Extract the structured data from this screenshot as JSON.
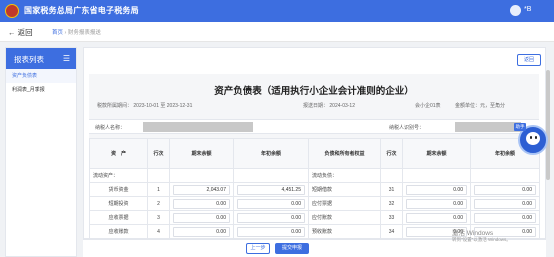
{
  "header": {
    "title": "国家税务总局广东省电子税务局",
    "user": "*B"
  },
  "subbar": {
    "back_label": "返回",
    "crumb_home": "首页",
    "crumb_sep": " › ",
    "crumb_current": "财务报表报送"
  },
  "sidebar": {
    "title": "报表列表",
    "items": [
      {
        "label": "资产负债表",
        "active": true
      },
      {
        "label": "利润表_月季报",
        "active": false
      }
    ]
  },
  "main": {
    "return_label": "返回",
    "form_title": "资产负债表（适用执行小企业会计准则的企业）",
    "meta": {
      "period_label": "税款所属期间：",
      "period_start": "2023-10-01",
      "period_to": "至",
      "period_end": "2023-12-31",
      "fill_date_label": "报送日期：",
      "fill_date": "2024-03-12",
      "form_code": "会小企01表",
      "unit_label": "金额单位：元，至角分"
    },
    "taxpayer_name_label": "纳税人名称：",
    "taxpayer_id_label": "纳税人识别号：",
    "columns": {
      "asset": "资　产",
      "row_no": "行次",
      "end_balance": "期末余额",
      "begin_balance": "年初余额",
      "liability": "负债和所有者权益",
      "row_no2": "行次",
      "end_balance2": "期末余额",
      "begin_balance2": "年初余额"
    },
    "section_left": "流动资产：",
    "section_right": "流动负债：",
    "rows": [
      {
        "left_label": "货币资金",
        "left_no": "1",
        "left_end": "2,043.07",
        "left_begin": "4,451.25",
        "right_label": "短期借款",
        "right_no": "31",
        "right_end": "0.00",
        "right_begin": "0.00"
      },
      {
        "left_label": "短期投资",
        "left_no": "2",
        "left_end": "0.00",
        "left_begin": "0.00",
        "right_label": "应付票据",
        "right_no": "32",
        "right_end": "0.00",
        "right_begin": "0.00"
      },
      {
        "left_label": "应收票据",
        "left_no": "3",
        "left_end": "0.00",
        "left_begin": "0.00",
        "right_label": "应付账款",
        "right_no": "33",
        "right_end": "0.00",
        "right_begin": "0.00"
      },
      {
        "left_label": "应收账款",
        "left_no": "4",
        "left_end": "0.00",
        "left_begin": "0.00",
        "right_label": "预收账款",
        "right_no": "34",
        "right_end": "0.00",
        "right_begin": "0.00"
      }
    ]
  },
  "footer": {
    "prev_label": "上一步",
    "submit_label": "提交申报"
  },
  "assistant": {
    "tag": "助手"
  },
  "watermark": {
    "line1": "激活 Windows",
    "line2": "转到\"设置\"以激活 Windows。"
  },
  "colors": {
    "primary": "#3d6ee0",
    "background": "#f0f2f5"
  }
}
